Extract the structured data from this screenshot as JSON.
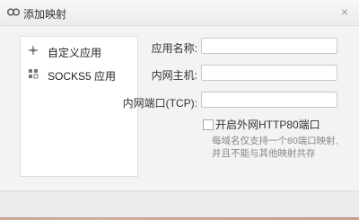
{
  "window": {
    "title": "添加映射",
    "close_glyph": "×"
  },
  "sidebar": {
    "items": [
      {
        "label": "自定义应用",
        "icon": "puzzle-icon"
      },
      {
        "label": "SOCKS5 应用",
        "icon": "grid-icon"
      }
    ]
  },
  "form": {
    "app_name": {
      "label": "应用名称:",
      "value": "",
      "placeholder": ""
    },
    "intranet_host": {
      "label": "内网主机:",
      "value": "",
      "placeholder": ""
    },
    "intranet_port": {
      "label": "内网端口(TCP):",
      "value": "",
      "placeholder": ""
    },
    "http80": {
      "label": "开启外网HTTP80端口",
      "checked": false,
      "hint_lines": [
        "每域名仅支持一个80端口映射,",
        "并且不能与其他映射共存"
      ]
    }
  },
  "colors": {
    "background": "#cfa596",
    "dialog": "#f3f3f3",
    "input_border": "#c9c9c9"
  }
}
